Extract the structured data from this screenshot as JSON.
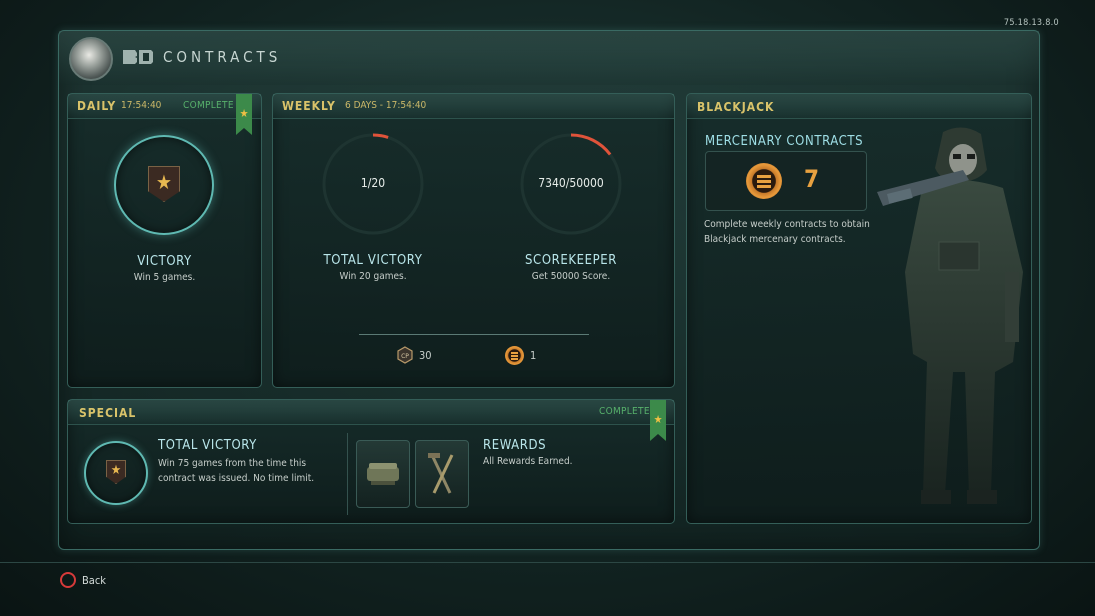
{
  "version": "75.18.13.8.0",
  "header": {
    "title": "CONTRACTS",
    "emblem_icon": "prestige-emblem-icon",
    "logo_icon": "bo4-logo-icon"
  },
  "daily": {
    "title": "DAILY",
    "timer": "17:54:40",
    "status": "COMPLETE",
    "contract": {
      "name": "VICTORY",
      "description": "Win 5 games.",
      "progress": 1.0
    }
  },
  "weekly": {
    "title": "WEEKLY",
    "timer": "6 DAYS - 17:54:40",
    "contracts": [
      {
        "name": "TOTAL VICTORY",
        "description": "Win 20 games.",
        "progress_text": "1/20",
        "progress": 0.05
      },
      {
        "name": "SCOREKEEPER",
        "description": "Get 50000 Score.",
        "progress_text": "7340/50000",
        "progress": 0.1468
      }
    ],
    "rewards": [
      {
        "icon": "cod-points-icon",
        "value": "30"
      },
      {
        "icon": "mercenary-contract-icon",
        "value": "1"
      }
    ]
  },
  "special": {
    "title": "SPECIAL",
    "status": "COMPLETE",
    "contract": {
      "name": "TOTAL VICTORY",
      "description_line1": "Win 75 games from the time this",
      "description_line2": "contract was issued. No time limit."
    },
    "rewards_title": "REWARDS",
    "rewards_text": "All Rewards Earned."
  },
  "blackjack": {
    "title": "BLACKJACK",
    "subtitle": "MERCENARY CONTRACTS",
    "count": "7",
    "info_line1": "Complete weekly contracts to obtain",
    "info_line2": "Blackjack mercenary contracts."
  },
  "footer": {
    "back_label": "Back",
    "back_icon": "circle-button-icon"
  },
  "colors": {
    "accent_gold": "#d9c36a",
    "complete_green": "#57b06b",
    "progress_red": "#e0533a",
    "name_cyan": "#b9e6ea"
  }
}
